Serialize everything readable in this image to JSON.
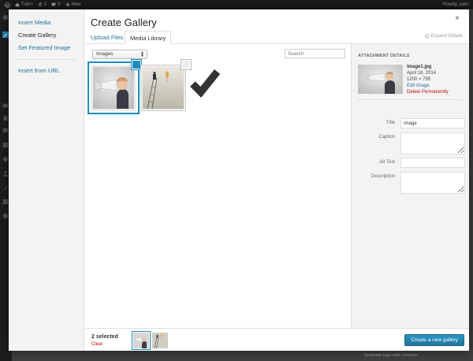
{
  "admin_bar": {
    "site_name": "Tuts+",
    "updates_count": "1",
    "comments_count": "0",
    "new_label": "New",
    "howdy": "Howdy, sam"
  },
  "modal": {
    "menu": [
      {
        "label": "Insert Media",
        "active": false
      },
      {
        "label": "Create Gallery",
        "active": true
      },
      {
        "label": "Set Featured Image",
        "active": false
      },
      {
        "label": "Insert from URL",
        "active": false
      }
    ],
    "title": "Create Gallery",
    "close_icon": "×",
    "tabs": [
      {
        "label": "Upload Files",
        "active": false
      },
      {
        "label": "Media Library",
        "active": true
      }
    ],
    "expand_details": "Expand Details",
    "filter": {
      "selected": "Images"
    },
    "search": {
      "placeholder": "Search"
    },
    "attachments": [
      {
        "name": "megaphone-boy",
        "selected": true,
        "details": true
      },
      {
        "name": "balloon-ladder",
        "selected": true,
        "details": false
      }
    ],
    "details": {
      "heading": "Attachment Details",
      "filename": "Image1.jpg",
      "date": "April 16, 2014",
      "dimensions": "1200 × 795",
      "edit_link": "Edit Image",
      "delete_link": "Delete Permanently",
      "fields": {
        "title": {
          "label": "Title",
          "value": "Image"
        },
        "caption": {
          "label": "Caption",
          "value": ""
        },
        "alt": {
          "label": "Alt Text",
          "value": ""
        },
        "description": {
          "label": "Description",
          "value": ""
        }
      }
    },
    "selection": {
      "count_text": "2 selected",
      "clear_label": "Clear"
    },
    "primary_button": "Create a new gallery"
  },
  "background_text": "Separate tags with commas",
  "colors": {
    "accent": "#1e8cbe",
    "link": "#21759b",
    "danger": "#bc0b0b"
  }
}
